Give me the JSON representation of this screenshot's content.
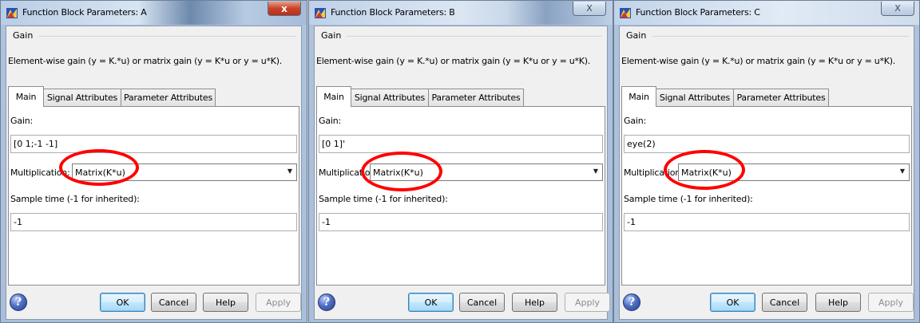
{
  "dialogs": [
    {
      "title": "Function Block Parameters: A",
      "close_label": "x",
      "group_title": "Gain",
      "description": "Element-wise gain (y = K.*u) or matrix gain (y = K*u or y = u*K).",
      "tabs": [
        "Main",
        "Signal Attributes",
        "Parameter Attributes"
      ],
      "gain_label": "Gain:",
      "gain_value": "[0 1;-1 -1]",
      "multiplication_label": "Multiplication:",
      "multiplication_value": "Matrix(K*u)",
      "sample_time_label": "Sample time (-1 for inherited):",
      "sample_time_value": "-1",
      "buttons": {
        "ok": "OK",
        "cancel": "Cancel",
        "help": "Help",
        "apply": "Apply"
      }
    },
    {
      "title": "Function Block Parameters: B",
      "close_label": "X",
      "group_title": "Gain",
      "description": "Element-wise gain (y = K.*u) or matrix gain (y = K*u or y = u*K).",
      "tabs": [
        "Main",
        "Signal Attributes",
        "Parameter Attributes"
      ],
      "gain_label": "Gain:",
      "gain_value": "[0 1]'",
      "multiplication_label": "Multiplication:",
      "multiplication_value": "Matrix(K*u)",
      "sample_time_label": "Sample time (-1 for inherited):",
      "sample_time_value": "-1",
      "buttons": {
        "ok": "OK",
        "cancel": "Cancel",
        "help": "Help",
        "apply": "Apply"
      }
    },
    {
      "title": "Function Block Parameters: C",
      "close_label": "X",
      "group_title": "Gain",
      "description": "Element-wise gain (y = K.*u) or matrix gain (y = K*u or y = u*K).",
      "tabs": [
        "Main",
        "Signal Attributes",
        "Parameter Attributes"
      ],
      "gain_label": "Gain:",
      "gain_value": "eye(2)",
      "multiplication_label": "Multiplication:",
      "multiplication_value": "Matrix(K*u)",
      "sample_time_label": "Sample time (-1 for inherited):",
      "sample_time_value": "-1",
      "buttons": {
        "ok": "OK",
        "cancel": "Cancel",
        "help": "Help",
        "apply": "Apply"
      }
    }
  ],
  "colors": {
    "highlight_circle": "#ff0000",
    "window_frame": "#aec3de",
    "close_button_active": "#c7442a"
  },
  "icons": {
    "app": "simulink-block-icon",
    "help": "question-mark-icon",
    "dropdown": "chevron-down-icon"
  }
}
